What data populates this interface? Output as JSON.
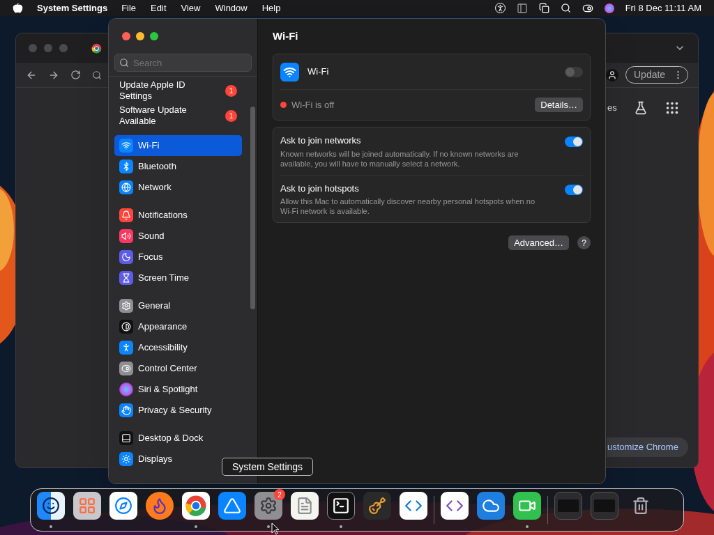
{
  "menu_bar": {
    "app_name": "System Settings",
    "menus": [
      "File",
      "Edit",
      "View",
      "Window",
      "Help"
    ],
    "clock": "Fri 8 Dec 11:11 AM"
  },
  "browser_window": {
    "update_button": "Update",
    "partial_label": "es",
    "customize_button": "ustomize Chrome"
  },
  "settings": {
    "search": {
      "placeholder": "Search"
    },
    "sidebar": [
      [
        {
          "label": "Update Apple ID Settings",
          "kind": "notice",
          "badge": "1",
          "selected": false
        },
        {
          "label": "Software Update Available",
          "kind": "notice",
          "badge": "1",
          "selected": false
        }
      ],
      [
        {
          "label": "Wi-Fi",
          "kind": "wifi",
          "selected": true
        },
        {
          "label": "Bluetooth",
          "kind": "bluetooth",
          "selected": false
        },
        {
          "label": "Network",
          "kind": "network",
          "selected": false
        }
      ],
      [
        {
          "label": "Notifications",
          "kind": "notifications",
          "selected": false
        },
        {
          "label": "Sound",
          "kind": "sound",
          "selected": false
        },
        {
          "label": "Focus",
          "kind": "focus",
          "selected": false
        },
        {
          "label": "Screen Time",
          "kind": "screen_time",
          "selected": false
        }
      ],
      [
        {
          "label": "General",
          "kind": "general",
          "selected": false
        },
        {
          "label": "Appearance",
          "kind": "appearance",
          "selected": false
        },
        {
          "label": "Accessibility",
          "kind": "accessibility",
          "selected": false
        },
        {
          "label": "Control Center",
          "kind": "control_center",
          "selected": false
        },
        {
          "label": "Siri & Spotlight",
          "kind": "siri",
          "selected": false
        },
        {
          "label": "Privacy & Security",
          "kind": "privacy",
          "selected": false
        }
      ],
      [
        {
          "label": "Desktop & Dock",
          "kind": "desktop_dock",
          "selected": false
        },
        {
          "label": "Displays",
          "kind": "displays",
          "selected": false
        }
      ]
    ],
    "page_title": "Wi-Fi",
    "wifi": {
      "label": "Wi-Fi",
      "on": false,
      "status": "Wi-Fi is off",
      "details_button": "Details…"
    },
    "options": [
      {
        "title": "Ask to join networks",
        "description": "Known networks will be joined automatically. If no known networks are available, you will have to manually select a network.",
        "on": true
      },
      {
        "title": "Ask to join hotspots",
        "description": "Allow this Mac to automatically discover nearby personal hotspots when no Wi-Fi network is available.",
        "on": true
      }
    ],
    "advanced_button": "Advanced…",
    "help_button": "?"
  },
  "tooltip": "System Settings",
  "dock": [
    [
      {
        "kind": "finder",
        "running": true
      },
      {
        "kind": "launchpad",
        "running": false
      },
      {
        "kind": "safari",
        "running": false
      },
      {
        "kind": "firefox",
        "running": false
      },
      {
        "kind": "chrome",
        "running": true
      },
      {
        "kind": "appstore",
        "running": false
      },
      {
        "kind": "settings",
        "running": true,
        "badge": "2"
      },
      {
        "kind": "textedit",
        "running": false
      },
      {
        "kind": "terminal",
        "running": true
      },
      {
        "kind": "garageband",
        "running": false
      },
      {
        "kind": "vscode",
        "running": false
      }
    ],
    [
      {
        "kind": "visualstudio",
        "running": false
      },
      {
        "kind": "weather",
        "running": false
      },
      {
        "kind": "facetime",
        "running": true
      }
    ],
    [
      {
        "kind": "window",
        "running": false
      },
      {
        "kind": "window",
        "running": false
      },
      {
        "kind": "trash",
        "running": false
      }
    ]
  ]
}
